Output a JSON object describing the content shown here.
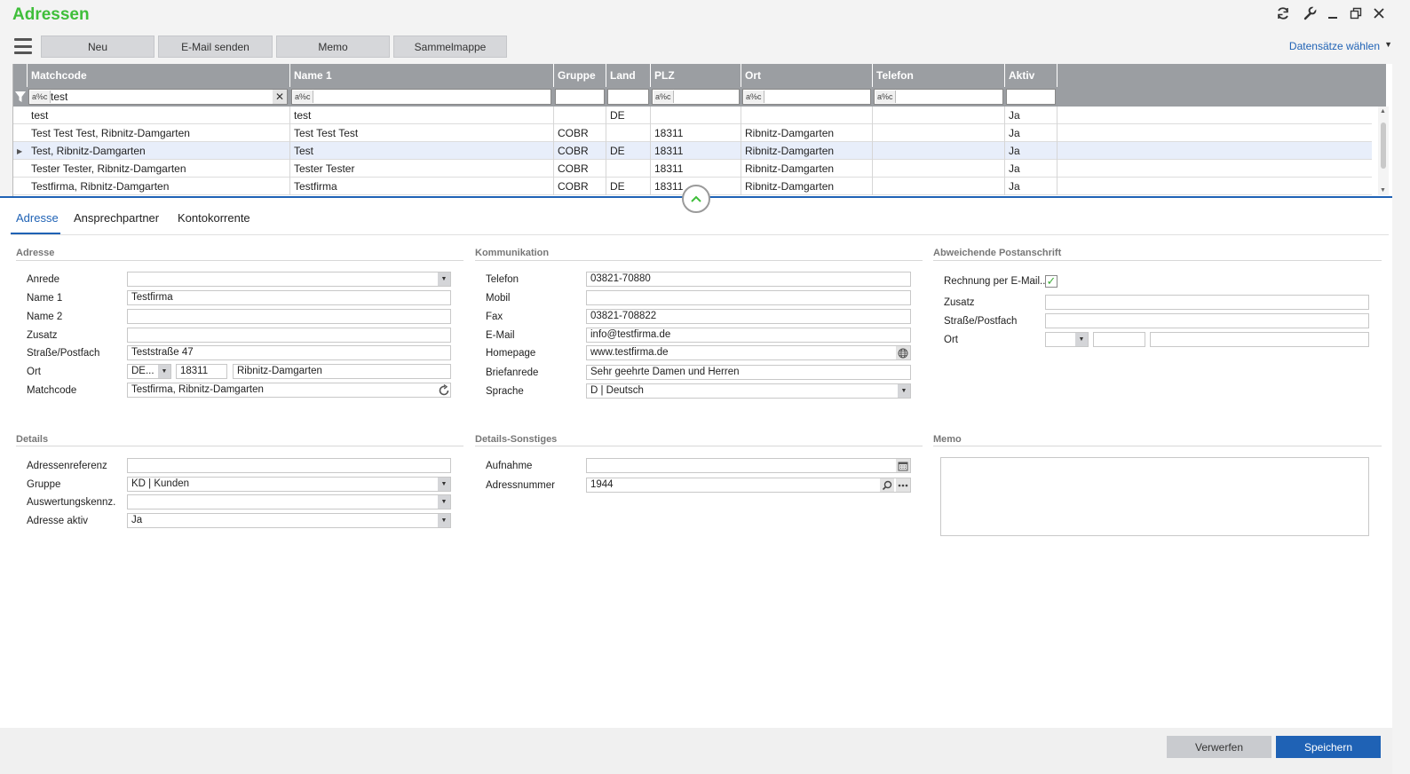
{
  "app": {
    "title": "Adressen"
  },
  "window_icons": [
    "refresh-icon",
    "wrench-icon",
    "minimize-icon",
    "restore-icon",
    "close-icon"
  ],
  "toolbar": {
    "buttons": [
      "Neu",
      "E-Mail senden",
      "Memo",
      "Sammelmappe"
    ],
    "records_select": "Datensätze wählen"
  },
  "grid": {
    "columns": [
      "Matchcode",
      "Name 1",
      "Gruppe",
      "Land",
      "PLZ",
      "Ort",
      "Telefon",
      "Aktiv"
    ],
    "filter": {
      "prefix": "a%c",
      "matchcode": "test"
    },
    "rows": [
      [
        "test",
        "test",
        "",
        "DE",
        "",
        "",
        "",
        "Ja"
      ],
      [
        "Test Test Test, Ribnitz-Damgarten",
        "Test Test Test",
        "COBR",
        "",
        "18311",
        "Ribnitz-Damgarten",
        "",
        "Ja"
      ],
      [
        "Test, Ribnitz-Damgarten",
        "Test",
        "COBR",
        "DE",
        "18311",
        "Ribnitz-Damgarten",
        "",
        "Ja"
      ],
      [
        "Tester Tester, Ribnitz-Damgarten",
        "Tester Tester",
        "COBR",
        "",
        "18311",
        "Ribnitz-Damgarten",
        "",
        "Ja"
      ],
      [
        "Testfirma, Ribnitz-Damgarten",
        "Testfirma",
        "COBR",
        "DE",
        "18311",
        "Ribnitz-Damgarten",
        "",
        "Ja"
      ]
    ],
    "selected_row": 2
  },
  "tabs": [
    "Adresse",
    "Ansprechpartner",
    "Kontokorrente"
  ],
  "adresse": {
    "title": "Adresse",
    "labels": {
      "anrede": "Anrede",
      "name1": "Name 1",
      "name2": "Name 2",
      "zusatz": "Zusatz",
      "strasse": "Straße/Postfach",
      "ort": "Ort",
      "matchcode": "Matchcode"
    },
    "values": {
      "anrede": "",
      "name1": "Testfirma",
      "name2": "",
      "zusatz": "",
      "strasse": "Teststraße 47",
      "land": "DE...",
      "plz": "18311",
      "ort": "Ribnitz-Damgarten",
      "matchcode": "Testfirma, Ribnitz-Damgarten"
    }
  },
  "kommunikation": {
    "title": "Kommunikation",
    "labels": {
      "telefon": "Telefon",
      "mobil": "Mobil",
      "fax": "Fax",
      "email": "E-Mail",
      "homepage": "Homepage",
      "briefanrede": "Briefanrede",
      "sprache": "Sprache"
    },
    "values": {
      "telefon": "03821-70880",
      "mobil": "",
      "fax": "03821-708822",
      "email": "info@testfirma.de",
      "homepage": "www.testfirma.de",
      "briefanrede": "Sehr geehrte Damen und Herren",
      "sprache": "D  |  Deutsch"
    }
  },
  "postanschrift": {
    "title": "Abweichende Postanschrift",
    "labels": {
      "rechnung": "Rechnung per E-Mail...",
      "zusatz": "Zusatz",
      "strasse": "Straße/Postfach",
      "ort": "Ort"
    },
    "rechnung_checked": true
  },
  "details": {
    "title": "Details",
    "labels": {
      "referenz": "Adressenreferenz",
      "gruppe": "Gruppe",
      "auswertung": "Auswertungskennz.",
      "aktiv": "Adresse aktiv"
    },
    "values": {
      "referenz": "",
      "gruppe": "KD  |  Kunden",
      "auswertung": "",
      "aktiv": "Ja"
    }
  },
  "details_sonstiges": {
    "title": "Details-Sonstiges",
    "labels": {
      "aufnahme": "Aufnahme",
      "adressnummer": "Adressnummer"
    },
    "values": {
      "aufnahme": "",
      "adressnummer": "1944"
    }
  },
  "memo": {
    "title": "Memo"
  },
  "footer": {
    "discard": "Verwerfen",
    "save": "Speichern"
  },
  "colors": {
    "accent_green": "#3fbe3a",
    "primary_blue": "#1f62b5",
    "grid_header": "#9b9ea2"
  }
}
